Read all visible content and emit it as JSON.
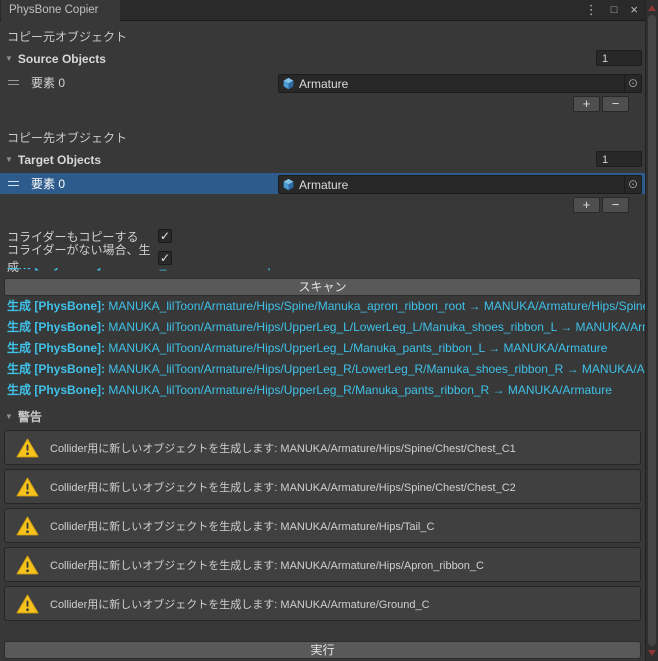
{
  "window": {
    "title": "PhysBone Copier",
    "menu_icon": "⋮",
    "maximize_icon": "□",
    "close_icon": "×"
  },
  "icons": {
    "foldout": "▼",
    "picker": "⊙",
    "check": "✓"
  },
  "source_section": {
    "heading": "コピー元オブジェクト",
    "foldout_label": "Source Objects",
    "size": "1",
    "element_label": "要素 0",
    "object_value": "Armature",
    "add_label": "+",
    "remove_label": "−"
  },
  "target_section": {
    "heading": "コピー先オブジェクト",
    "foldout_label": "Target Objects",
    "size": "1",
    "element_label": "要素 0",
    "object_value": "Armature",
    "add_label": "+",
    "remove_label": "−"
  },
  "options": {
    "copy_colliders": {
      "label": "コライダーもコピーする",
      "checked": "✓"
    },
    "create_if_missing": {
      "label": "コライダーがない場合、生成",
      "checked": "✓"
    }
  },
  "scan_button_label": "スキャン",
  "log_partial": {
    "prefix": "生成 [PhysBone]:",
    "text": " MANUKA_lilToon/Armature/Hips/"
  },
  "log_lines": [
    {
      "prefix": "生成 [PhysBone]:",
      "text": " MANUKA_lilToon/Armature/Hips/Spine/Manuka_apron_ribbon_root → MANUKA/Armature/Hips/Spine"
    },
    {
      "prefix": "生成 [PhysBone]:",
      "text": " MANUKA_lilToon/Armature/Hips/UpperLeg_L/LowerLeg_L/Manuka_shoes_ribbon_L → MANUKA/Armature"
    },
    {
      "prefix": "生成 [PhysBone]:",
      "text": " MANUKA_lilToon/Armature/Hips/UpperLeg_L/Manuka_pants_ribbon_L → MANUKA/Armature"
    },
    {
      "prefix": "生成 [PhysBone]:",
      "text": " MANUKA_lilToon/Armature/Hips/UpperLeg_R/LowerLeg_R/Manuka_shoes_ribbon_R → MANUKA/Armature"
    },
    {
      "prefix": "生成 [PhysBone]:",
      "text": " MANUKA_lilToon/Armature/Hips/UpperLeg_R/Manuka_pants_ribbon_R → MANUKA/Armature"
    }
  ],
  "warnings": {
    "foldout_label": "警告",
    "items": [
      "Collider用に新しいオブジェクトを生成します: MANUKA/Armature/Hips/Spine/Chest/Chest_C1",
      "Collider用に新しいオブジェクトを生成します: MANUKA/Armature/Hips/Spine/Chest/Chest_C2",
      "Collider用に新しいオブジェクトを生成します: MANUKA/Armature/Hips/Tail_C",
      "Collider用に新しいオブジェクトを生成します: MANUKA/Armature/Hips/Apron_ribbon_C",
      "Collider用に新しいオブジェクトを生成します: MANUKA/Armature/Ground_C"
    ]
  },
  "execute_button_label": "実行",
  "colors": {
    "accent_cyan": "#3fc1e8",
    "selection_blue": "#2d5c8c",
    "warning_yellow": "#f6c21c",
    "scroll_arrow_red": "#8d3434",
    "background": "#383838"
  }
}
